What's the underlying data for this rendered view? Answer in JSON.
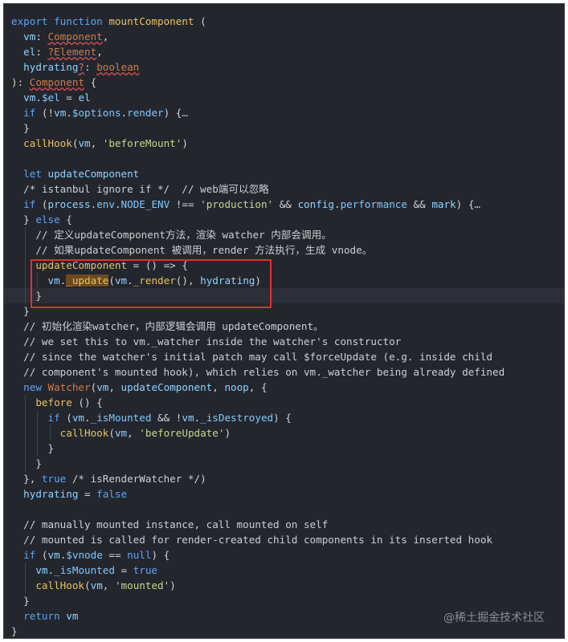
{
  "editor": {
    "lines": [
      {
        "indent": 0,
        "tokens": [
          [
            "kw",
            "export "
          ],
          [
            "kw",
            "function "
          ],
          [
            "fn",
            "mountComponent "
          ],
          [
            "punc",
            "("
          ]
        ]
      },
      {
        "indent": 1,
        "tokens": [
          [
            "var",
            "vm"
          ],
          [
            "punc",
            ": "
          ],
          [
            "type-err",
            "Component"
          ],
          [
            "punc",
            ","
          ]
        ]
      },
      {
        "indent": 1,
        "tokens": [
          [
            "var",
            "el"
          ],
          [
            "punc",
            ": "
          ],
          [
            "type-err",
            "?Element"
          ],
          [
            "punc",
            ","
          ]
        ]
      },
      {
        "indent": 1,
        "tokens": [
          [
            "var",
            "hydrating"
          ],
          [
            "type-err",
            "?"
          ],
          [
            "punc",
            ": "
          ],
          [
            "type-err",
            "boolean"
          ]
        ]
      },
      {
        "indent": 0,
        "tokens": [
          [
            "punc",
            "): "
          ],
          [
            "type-err",
            "Component"
          ],
          [
            "punc",
            " {"
          ]
        ]
      },
      {
        "indent": 1,
        "tokens": [
          [
            "var",
            "vm"
          ],
          [
            "punc",
            "."
          ],
          [
            "prop",
            "$el"
          ],
          [
            "op",
            " = "
          ],
          [
            "var",
            "el"
          ]
        ]
      },
      {
        "indent": 1,
        "tokens": [
          [
            "kw",
            "if "
          ],
          [
            "punc",
            "("
          ],
          [
            "op",
            "!"
          ],
          [
            "var",
            "vm"
          ],
          [
            "punc",
            "."
          ],
          [
            "prop",
            "$options"
          ],
          [
            "punc",
            "."
          ],
          [
            "prop",
            "render"
          ],
          [
            "punc",
            ") {"
          ],
          [
            "fold",
            "…"
          ]
        ]
      },
      {
        "indent": 1,
        "tokens": [
          [
            "punc",
            "}"
          ]
        ]
      },
      {
        "indent": 1,
        "tokens": [
          [
            "fn",
            "callHook"
          ],
          [
            "punc",
            "("
          ],
          [
            "var",
            "vm"
          ],
          [
            "punc",
            ", "
          ],
          [
            "str",
            "'beforeMount'"
          ],
          [
            "punc",
            ")"
          ]
        ]
      },
      {
        "indent": 0,
        "tokens": []
      },
      {
        "indent": 1,
        "tokens": [
          [
            "kw",
            "let "
          ],
          [
            "var",
            "updateComponent"
          ]
        ]
      },
      {
        "indent": 1,
        "tokens": [
          [
            "cm",
            "/* istanbul ignore if */  // web端可以忽略"
          ]
        ]
      },
      {
        "indent": 1,
        "tokens": [
          [
            "kw",
            "if "
          ],
          [
            "punc",
            "("
          ],
          [
            "var",
            "process"
          ],
          [
            "punc",
            "."
          ],
          [
            "prop",
            "env"
          ],
          [
            "punc",
            "."
          ],
          [
            "prop",
            "NODE_ENV"
          ],
          [
            "op",
            " !== "
          ],
          [
            "str",
            "'production'"
          ],
          [
            "op",
            " && "
          ],
          [
            "var",
            "config"
          ],
          [
            "punc",
            "."
          ],
          [
            "prop",
            "performance"
          ],
          [
            "op",
            " && "
          ],
          [
            "var",
            "mark"
          ],
          [
            "punc",
            ") {"
          ],
          [
            "fold",
            "…"
          ]
        ]
      },
      {
        "indent": 1,
        "tokens": [
          [
            "punc",
            "} "
          ],
          [
            "kw",
            "else "
          ],
          [
            "punc",
            "{"
          ]
        ]
      },
      {
        "indent": 2,
        "tokens": [
          [
            "cm",
            "// 定义updateComponent方法，渲染 watcher 内部会调用。"
          ]
        ]
      },
      {
        "indent": 2,
        "tokens": [
          [
            "cm",
            "// 如果updateComponent 被调用，render 方法执行，生成 vnode。"
          ]
        ]
      },
      {
        "indent": 2,
        "tokens": [
          [
            "fn",
            "updateComponent"
          ],
          [
            "op",
            " = "
          ],
          [
            "punc",
            "() "
          ],
          [
            "op",
            "=> "
          ],
          [
            "punc",
            "{"
          ]
        ]
      },
      {
        "indent": 3,
        "tokens": [
          [
            "var",
            "vm"
          ],
          [
            "punc",
            "."
          ],
          [
            "hl",
            "_update"
          ],
          [
            "punc",
            "("
          ],
          [
            "var",
            "vm"
          ],
          [
            "punc",
            "."
          ],
          [
            "fn",
            "_render"
          ],
          [
            "punc",
            "(), "
          ],
          [
            "var",
            "hydrating"
          ],
          [
            "punc",
            ")"
          ]
        ]
      },
      {
        "indent": 2,
        "current": true,
        "tokens": [
          [
            "punc",
            "}"
          ]
        ]
      },
      {
        "indent": 1,
        "tokens": [
          [
            "punc",
            "}"
          ]
        ]
      },
      {
        "indent": 1,
        "tokens": [
          [
            "cm",
            "// 初始化渲染watcher，内部逻辑会调用 updateComponent。"
          ]
        ]
      },
      {
        "indent": 1,
        "tokens": [
          [
            "cm",
            "// we set this to vm._watcher inside the watcher's constructor"
          ]
        ]
      },
      {
        "indent": 1,
        "tokens": [
          [
            "cm",
            "// since the watcher's initial patch may call $forceUpdate (e.g. inside child"
          ]
        ]
      },
      {
        "indent": 1,
        "tokens": [
          [
            "cm",
            "// component's mounted hook), which relies on vm._watcher being already defined"
          ]
        ]
      },
      {
        "indent": 1,
        "tokens": [
          [
            "kw",
            "new "
          ],
          [
            "type",
            "Watcher"
          ],
          [
            "punc",
            "("
          ],
          [
            "var",
            "vm"
          ],
          [
            "punc",
            ", "
          ],
          [
            "var",
            "updateComponent"
          ],
          [
            "punc",
            ", "
          ],
          [
            "var",
            "noop"
          ],
          [
            "punc",
            ", {"
          ]
        ]
      },
      {
        "indent": 2,
        "tokens": [
          [
            "fn",
            "before "
          ],
          [
            "punc",
            "() {"
          ]
        ]
      },
      {
        "indent": 3,
        "tokens": [
          [
            "kw",
            "if "
          ],
          [
            "punc",
            "("
          ],
          [
            "var",
            "vm"
          ],
          [
            "punc",
            "."
          ],
          [
            "prop",
            "_isMounted"
          ],
          [
            "op",
            " && !"
          ],
          [
            "var",
            "vm"
          ],
          [
            "punc",
            "."
          ],
          [
            "prop",
            "_isDestroyed"
          ],
          [
            "punc",
            ") {"
          ]
        ]
      },
      {
        "indent": 4,
        "tokens": [
          [
            "fn",
            "callHook"
          ],
          [
            "punc",
            "("
          ],
          [
            "var",
            "vm"
          ],
          [
            "punc",
            ", "
          ],
          [
            "str",
            "'beforeUpdate'"
          ],
          [
            "punc",
            ")"
          ]
        ]
      },
      {
        "indent": 3,
        "tokens": [
          [
            "punc",
            "}"
          ]
        ]
      },
      {
        "indent": 2,
        "tokens": [
          [
            "punc",
            "}"
          ]
        ]
      },
      {
        "indent": 1,
        "tokens": [
          [
            "punc",
            "}, "
          ],
          [
            "bool",
            "true"
          ],
          [
            "cm",
            " /* isRenderWatcher */"
          ],
          [
            "punc",
            ")"
          ]
        ]
      },
      {
        "indent": 1,
        "tokens": [
          [
            "var",
            "hydrating"
          ],
          [
            "op",
            " = "
          ],
          [
            "bool",
            "false"
          ]
        ]
      },
      {
        "indent": 0,
        "tokens": []
      },
      {
        "indent": 1,
        "tokens": [
          [
            "cm",
            "// manually mounted instance, call mounted on self"
          ]
        ]
      },
      {
        "indent": 1,
        "tokens": [
          [
            "cm",
            "// mounted is called for render-created child components in its inserted hook"
          ]
        ]
      },
      {
        "indent": 1,
        "tokens": [
          [
            "kw",
            "if "
          ],
          [
            "punc",
            "("
          ],
          [
            "var",
            "vm"
          ],
          [
            "punc",
            "."
          ],
          [
            "prop",
            "$vnode"
          ],
          [
            "op",
            " == "
          ],
          [
            "bool",
            "null"
          ],
          [
            "punc",
            ") {"
          ]
        ]
      },
      {
        "indent": 2,
        "tokens": [
          [
            "var",
            "vm"
          ],
          [
            "punc",
            "."
          ],
          [
            "prop",
            "_isMounted"
          ],
          [
            "op",
            " = "
          ],
          [
            "bool",
            "true"
          ]
        ]
      },
      {
        "indent": 2,
        "tokens": [
          [
            "fn",
            "callHook"
          ],
          [
            "punc",
            "("
          ],
          [
            "var",
            "vm"
          ],
          [
            "punc",
            ", "
          ],
          [
            "str",
            "'mounted'"
          ],
          [
            "punc",
            ")"
          ]
        ]
      },
      {
        "indent": 1,
        "tokens": [
          [
            "punc",
            "}"
          ]
        ]
      },
      {
        "indent": 1,
        "tokens": [
          [
            "kw",
            "return "
          ],
          [
            "var",
            "vm"
          ]
        ]
      },
      {
        "indent": 0,
        "tokens": [
          [
            "punc",
            "}"
          ]
        ]
      }
    ]
  },
  "watermark": "@稀土掘金技术社区",
  "colors": {
    "background": "#24262e",
    "highlight_box": "#e0302d"
  }
}
